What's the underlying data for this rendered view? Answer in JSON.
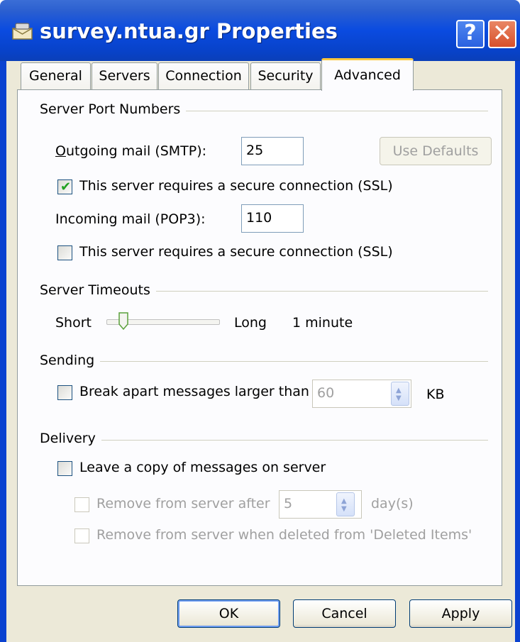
{
  "window": {
    "title": "survey.ntua.gr Properties",
    "help_symbol": "?",
    "close_symbol": "✕",
    "icon": "mail-server-icon"
  },
  "tabs": [
    {
      "label": "General",
      "active": false
    },
    {
      "label": "Servers",
      "active": false
    },
    {
      "label": "Connection",
      "active": false
    },
    {
      "label": "Security",
      "active": false
    },
    {
      "label": "Advanced",
      "active": true
    }
  ],
  "port_numbers": {
    "group_label": "Server Port Numbers",
    "outgoing_label": "Outgoing mail (SMTP):",
    "outgoing_value": "25",
    "use_defaults_label": "Use Defaults",
    "outgoing_ssl_label": "This server requires a secure connection (SSL)",
    "outgoing_ssl_checked": true,
    "incoming_label": "Incoming mail (POP3):",
    "incoming_value": "110",
    "incoming_ssl_label": "This server requires a secure connection (SSL)",
    "incoming_ssl_checked": false
  },
  "timeouts": {
    "group_label": "Server Timeouts",
    "short_label": "Short",
    "long_label": "Long",
    "value_label": "1 minute",
    "slider_level": 0.15
  },
  "sending": {
    "group_label": "Sending",
    "break_apart_label": "Break apart messages larger than",
    "break_apart_checked": false,
    "size_value": "60",
    "unit_label": "KB"
  },
  "delivery": {
    "group_label": "Delivery",
    "leave_copy_label": "Leave a copy of messages on server",
    "leave_copy_checked": false,
    "remove_after_label": "Remove from server after",
    "remove_after_value": "5",
    "days_label": "day(s)",
    "remove_deleted_label": "Remove from server when deleted from 'Deleted Items'"
  },
  "buttons": {
    "ok": "OK",
    "cancel": "Cancel",
    "apply": "Apply"
  }
}
